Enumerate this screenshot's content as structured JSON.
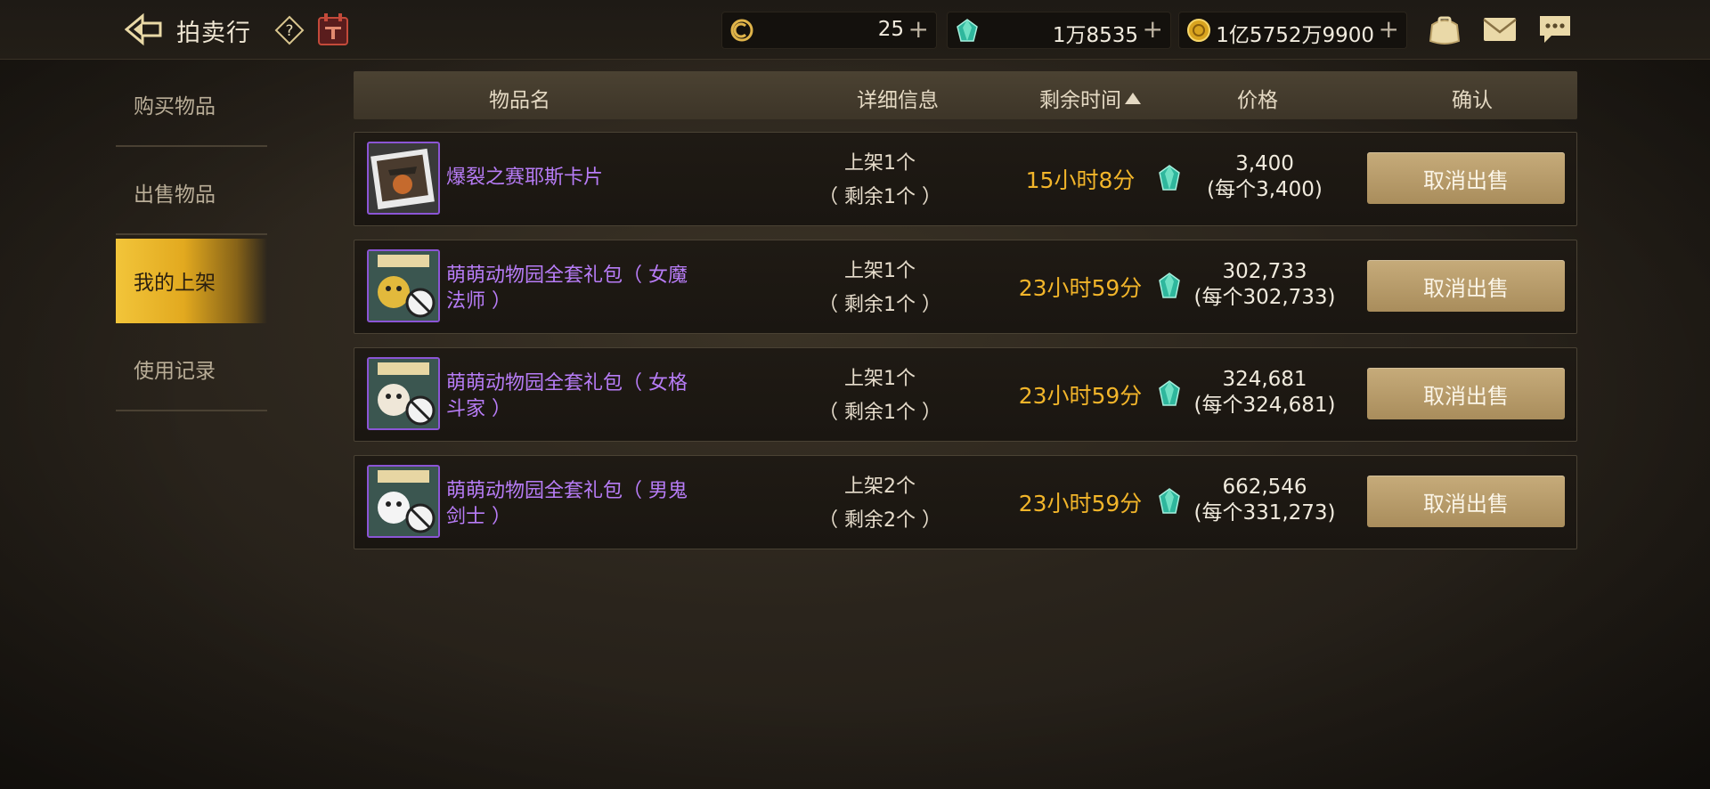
{
  "header": {
    "title": "拍卖行",
    "currencies": [
      {
        "icon": "clock-token-icon",
        "value": "25"
      },
      {
        "icon": "gem-icon",
        "value": "1万8535"
      },
      {
        "icon": "gold-coin-icon",
        "value": "1亿5752万9900"
      }
    ],
    "plus_label": "+"
  },
  "sidebar": {
    "items": [
      {
        "label": "购买物品",
        "active": false
      },
      {
        "label": "出售物品",
        "active": false
      },
      {
        "label": "我的上架",
        "active": true
      },
      {
        "label": "使用记录",
        "active": false
      }
    ]
  },
  "table": {
    "headers": {
      "name": "物品名",
      "detail": "详细信息",
      "time": "剩余时间",
      "price": "价格",
      "confirm": "确认"
    },
    "sort": {
      "column": "time",
      "direction": "ascending"
    },
    "rows": [
      {
        "name": "爆裂之赛耶斯卡片",
        "listed": "上架1个",
        "remaining": "（ 剩余1个 ）",
        "time": "15小时8分",
        "price": "3,400",
        "unit_price": "(每个3,400)",
        "action": "取消出售",
        "thumb": "card-icon"
      },
      {
        "name": "萌萌动物园全套礼包（ 女魔法师 ）",
        "listed": "上架1个",
        "remaining": "（ 剩余1个 ）",
        "time": "23小时59分",
        "price": "302,733",
        "unit_price": "(每个302,733)",
        "action": "取消出售",
        "thumb": "gift-package-icon"
      },
      {
        "name": "萌萌动物园全套礼包（ 女格斗家 ）",
        "listed": "上架1个",
        "remaining": "（ 剩余1个 ）",
        "time": "23小时59分",
        "price": "324,681",
        "unit_price": "(每个324,681)",
        "action": "取消出售",
        "thumb": "gift-package-icon"
      },
      {
        "name": "萌萌动物园全套礼包（ 男鬼剑士 ）",
        "listed": "上架2个",
        "remaining": "（ 剩余2个 ）",
        "time": "23小时59分",
        "price": "662,546",
        "unit_price": "(每个331,273)",
        "action": "取消出售",
        "thumb": "gift-package-icon"
      }
    ]
  },
  "colors": {
    "item_name": "#b77cf6",
    "time": "#f2b52a",
    "button": "#b89a68",
    "active_tab": "#f2c53a"
  }
}
